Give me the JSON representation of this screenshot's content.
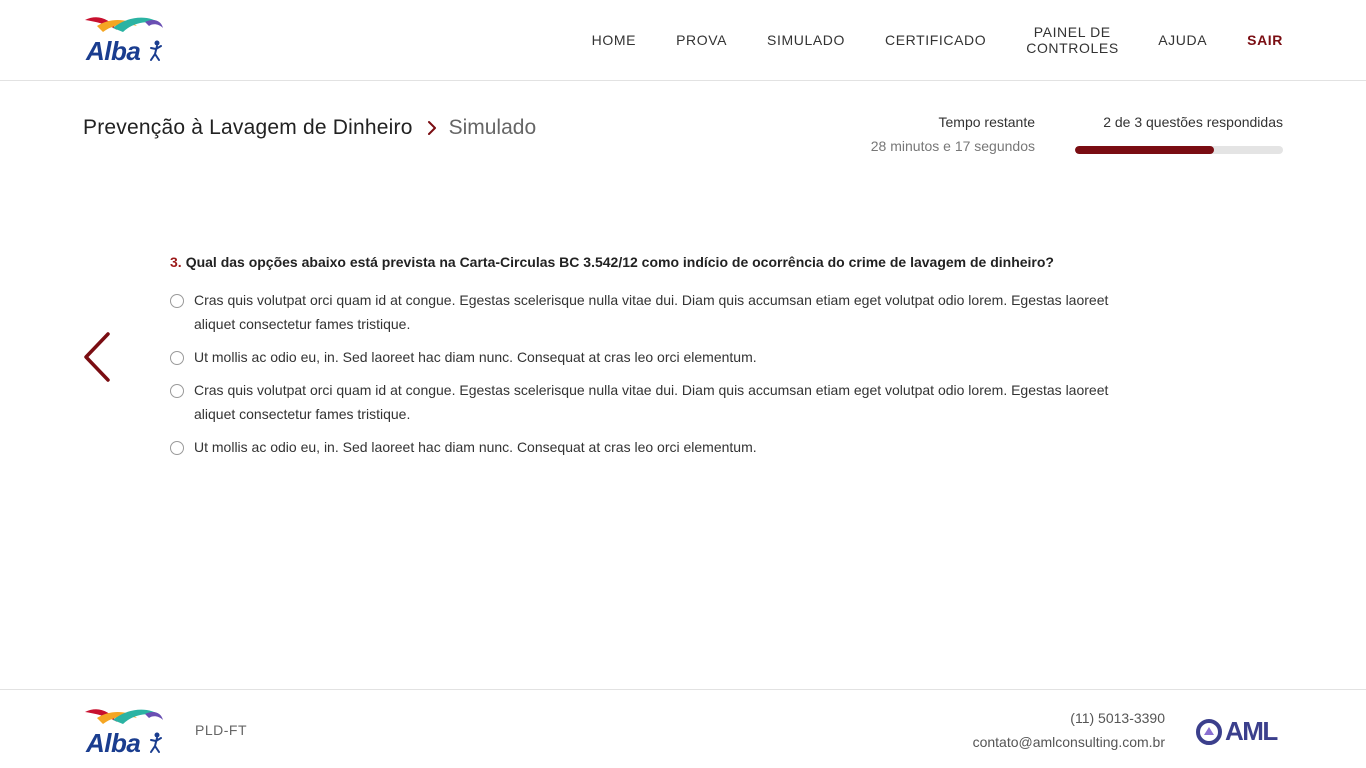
{
  "header": {
    "logo_text": "Alba",
    "nav": [
      {
        "label": "HOME"
      },
      {
        "label": "PROVA"
      },
      {
        "label": "SIMULADO"
      },
      {
        "label": "CERTIFICADO"
      },
      {
        "label": "PAINEL DE CONTROLES"
      },
      {
        "label": "AJUDA"
      },
      {
        "label": "SAIR"
      }
    ]
  },
  "breadcrumb": {
    "course": "Prevenção à Lavagem de Dinheiro",
    "current": "Simulado"
  },
  "timer": {
    "label": "Tempo restante",
    "value": "28 minutos e 17 segundos"
  },
  "progress": {
    "label": "2 de 3 questões respondidas",
    "answered": 2,
    "total": 3
  },
  "question": {
    "number": "3.",
    "text": "Qual das opções abaixo está prevista na Carta-Circulas BC 3.542/12 como indício de ocorrência do crime de lavagem de dinheiro?",
    "options": [
      {
        "text": "Cras quis volutpat orci quam id at congue. Egestas scelerisque nulla vitae dui. Diam quis accumsan etiam eget volutpat odio lorem. Egestas laoreet aliquet consectetur fames tristique."
      },
      {
        "text": "Ut mollis ac odio eu, in. Sed laoreet hac diam nunc. Consequat at cras leo orci elementum."
      },
      {
        "text": "Cras quis volutpat orci quam id at congue. Egestas scelerisque nulla vitae dui. Diam quis accumsan etiam eget volutpat odio lorem. Egestas laoreet aliquet consectetur fames tristique."
      },
      {
        "text": "Ut mollis ac odio eu, in. Sed laoreet hac diam nunc. Consequat at cras leo orci elementum."
      }
    ]
  },
  "footer": {
    "logo_text": "Alba",
    "tag": "PLD-FT",
    "phone": "(11) 5013-3390",
    "email": "contato@amlconsulting.com.br",
    "partner_logo_text": "AML"
  },
  "colors": {
    "accent": "#7a0d12",
    "brand_blue": "#1a3d8f",
    "partner_purple": "#3b3f8c"
  },
  "icons": {
    "prev": "chevron-left-icon",
    "breadcrumb_separator": "chevron-right-icon"
  }
}
